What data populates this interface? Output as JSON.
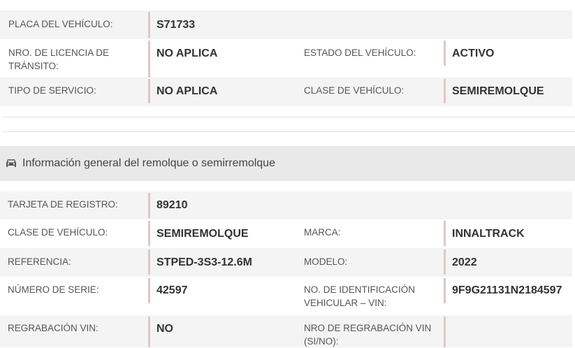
{
  "vehicle": {
    "placa": {
      "label": "PLACA DEL VEHÍCULO:",
      "value": "S71733"
    },
    "licencia": {
      "label1": "NRO. DE LICENCIA DE",
      "label2": "TRÁNSITO:",
      "value": "NO APLICA"
    },
    "estado": {
      "label": "ESTADO DEL VEHÍCULO:",
      "value": "ACTIVO"
    },
    "tipo_servicio": {
      "label": "TIPO DE SERVICIO:",
      "value": "NO APLICA"
    },
    "clase": {
      "label": "CLASE DE VEHÍCULO:",
      "value": "SEMIREMOLQUE"
    }
  },
  "section": {
    "icon": "car-icon",
    "title": "Información general del remolque o semirremolque"
  },
  "trailer": {
    "tarjeta": {
      "label": "TARJETA DE REGISTRO:",
      "value": "89210"
    },
    "clase": {
      "label": "CLASE DE VEHÍCULO:",
      "value": "SEMIREMOLQUE"
    },
    "marca": {
      "label": "MARCA:",
      "value": "INNALTRACK"
    },
    "referencia": {
      "label": "REFERENCIA:",
      "value": "STPED-3S3-12.6M"
    },
    "modelo": {
      "label": "MODELO:",
      "value": "2022"
    },
    "serie": {
      "label": "NÚMERO DE SERIE:",
      "value": "42597"
    },
    "vin": {
      "label1": "NO. DE IDENTIFICACIÓN",
      "label2": "VEHICULAR – VIN:",
      "value": "9F9G21131N2184597"
    },
    "regrabacion": {
      "label": "REGRABACIÓN VIN:",
      "value": "NO"
    },
    "nro_regrabacion": {
      "label1": "NRO DE REGRABACIÓN VIN",
      "label2": "(SI/NO):",
      "value": ""
    }
  },
  "colors": {
    "shade": "#f4f4f4",
    "separator": "#dcc8c8",
    "header_bg": "#e9e9e9"
  }
}
